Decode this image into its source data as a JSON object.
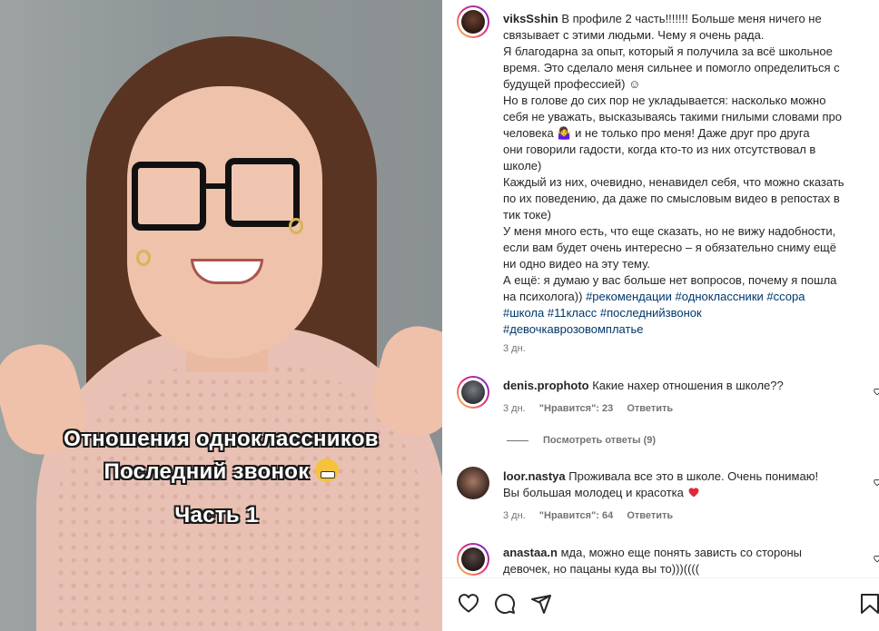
{
  "video_overlay": {
    "line1": "Отношения одноклассников",
    "line2": "Последний звонок",
    "line3": "Часть 1"
  },
  "caption": {
    "username": "viksSshin",
    "lines": [
      "В профиле 2 часть!!!!!!! Больше меня ничего не",
      "связывает с этими людьми. Чему я очень рада.",
      "Я благодарна за опыт, который я получила за всё школьное",
      "время. Это сделало меня сильнее и помогло определиться с",
      "будущей профессией) ☺",
      "Но в голове до сих пор не укладывается: насколько можно",
      "себя не уважать, высказываясь такими гнилыми словами про",
      "человека 🤷‍♀ и не только про меня! Даже друг про друга",
      "они говорили гадости, когда кто-то из них отсутствовал в",
      "школе)",
      "Каждый из них, очевидно, ненавидел себя, что можно сказать",
      "по их поведению, да даже по смысловым видео в репостах в",
      "тик токе)",
      "У меня много есть, что еще сказать, но не вижу надобности,",
      "если вам будет очень интересно – я обязательно сниму ещё",
      "ни одно видео на эту тему.",
      "А ещё: я думаю у вас больше нет вопросов, почему я пошла",
      "на психолога))"
    ],
    "hashtags_line1": "#рекомендации #одноклассники #ссора",
    "hashtags_line2": "#школа #11класс #последнийзвонок",
    "hashtags_line3": "#девочкаврозовомплатье",
    "time": "3 дн."
  },
  "comments": [
    {
      "username": "denis.prophoto",
      "text": "Какие нахер отношения в школе??",
      "time": "3 дн.",
      "likes": "\"Нравится\": 23",
      "reply": "Ответить",
      "view_replies": "Посмотреть ответы (9)"
    },
    {
      "username": "loor.nastya",
      "text": "Проживала все это в школе. Очень понимаю!",
      "text2": "Вы большая молодец и красотка",
      "time": "3 дн.",
      "likes": "\"Нравится\": 64",
      "reply": "Ответить"
    },
    {
      "username": "anastaa.n",
      "text": "мда, можно еще понять зависть со стороны",
      "text2": "девочек, но пацаны куда вы то)))(((("
    }
  ],
  "icons": {
    "like": "heart-icon",
    "comment": "comment-icon",
    "share": "share-icon",
    "save": "bookmark-icon"
  },
  "colors": {
    "hashtag": "#00376b",
    "meta": "#737373",
    "heart_red": "#ed4956"
  }
}
